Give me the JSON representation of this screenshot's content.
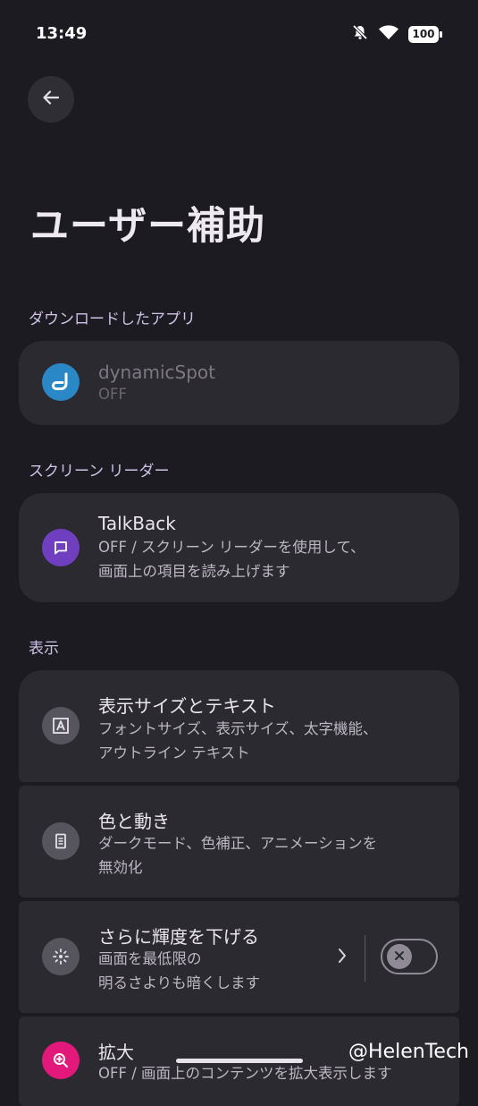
{
  "status_bar": {
    "time": "13:49",
    "battery": "100"
  },
  "page": {
    "title": "ユーザー補助"
  },
  "sections": {
    "downloaded": "ダウンロードしたアプリ",
    "screen_reader": "スクリーン リーダー",
    "display": "表示"
  },
  "items": {
    "dynamic_spot": {
      "title": "dynamicSpot",
      "subtitle": "OFF",
      "color": "#2b88c6"
    },
    "talkback": {
      "title": "TalkBack",
      "subtitle_line1": "OFF / スクリーン リーダーを使用して、",
      "subtitle_line2": "画面上の項目を読み上げます",
      "color": "#6f3fbf"
    },
    "display_size": {
      "title": "表示サイズとテキスト",
      "subtitle_line1": "フォントサイズ、表示サイズ、太字機能、",
      "subtitle_line2": "アウトライン テキスト"
    },
    "color_motion": {
      "title": "色と動き",
      "subtitle_line1": "ダークモード、色補正、アニメーションを",
      "subtitle_line2": "無効化"
    },
    "extra_dim": {
      "title": "さらに輝度を下げる",
      "subtitle_line1": "画面を最低限の",
      "subtitle_line2": "明るさよりも暗くします",
      "toggle_on": false
    },
    "magnification": {
      "title": "拡大",
      "subtitle_line1": "OFF / 画面上のコンテンツを拡大表示します",
      "color": "#e2197a"
    }
  },
  "watermark": "@HelenTech"
}
